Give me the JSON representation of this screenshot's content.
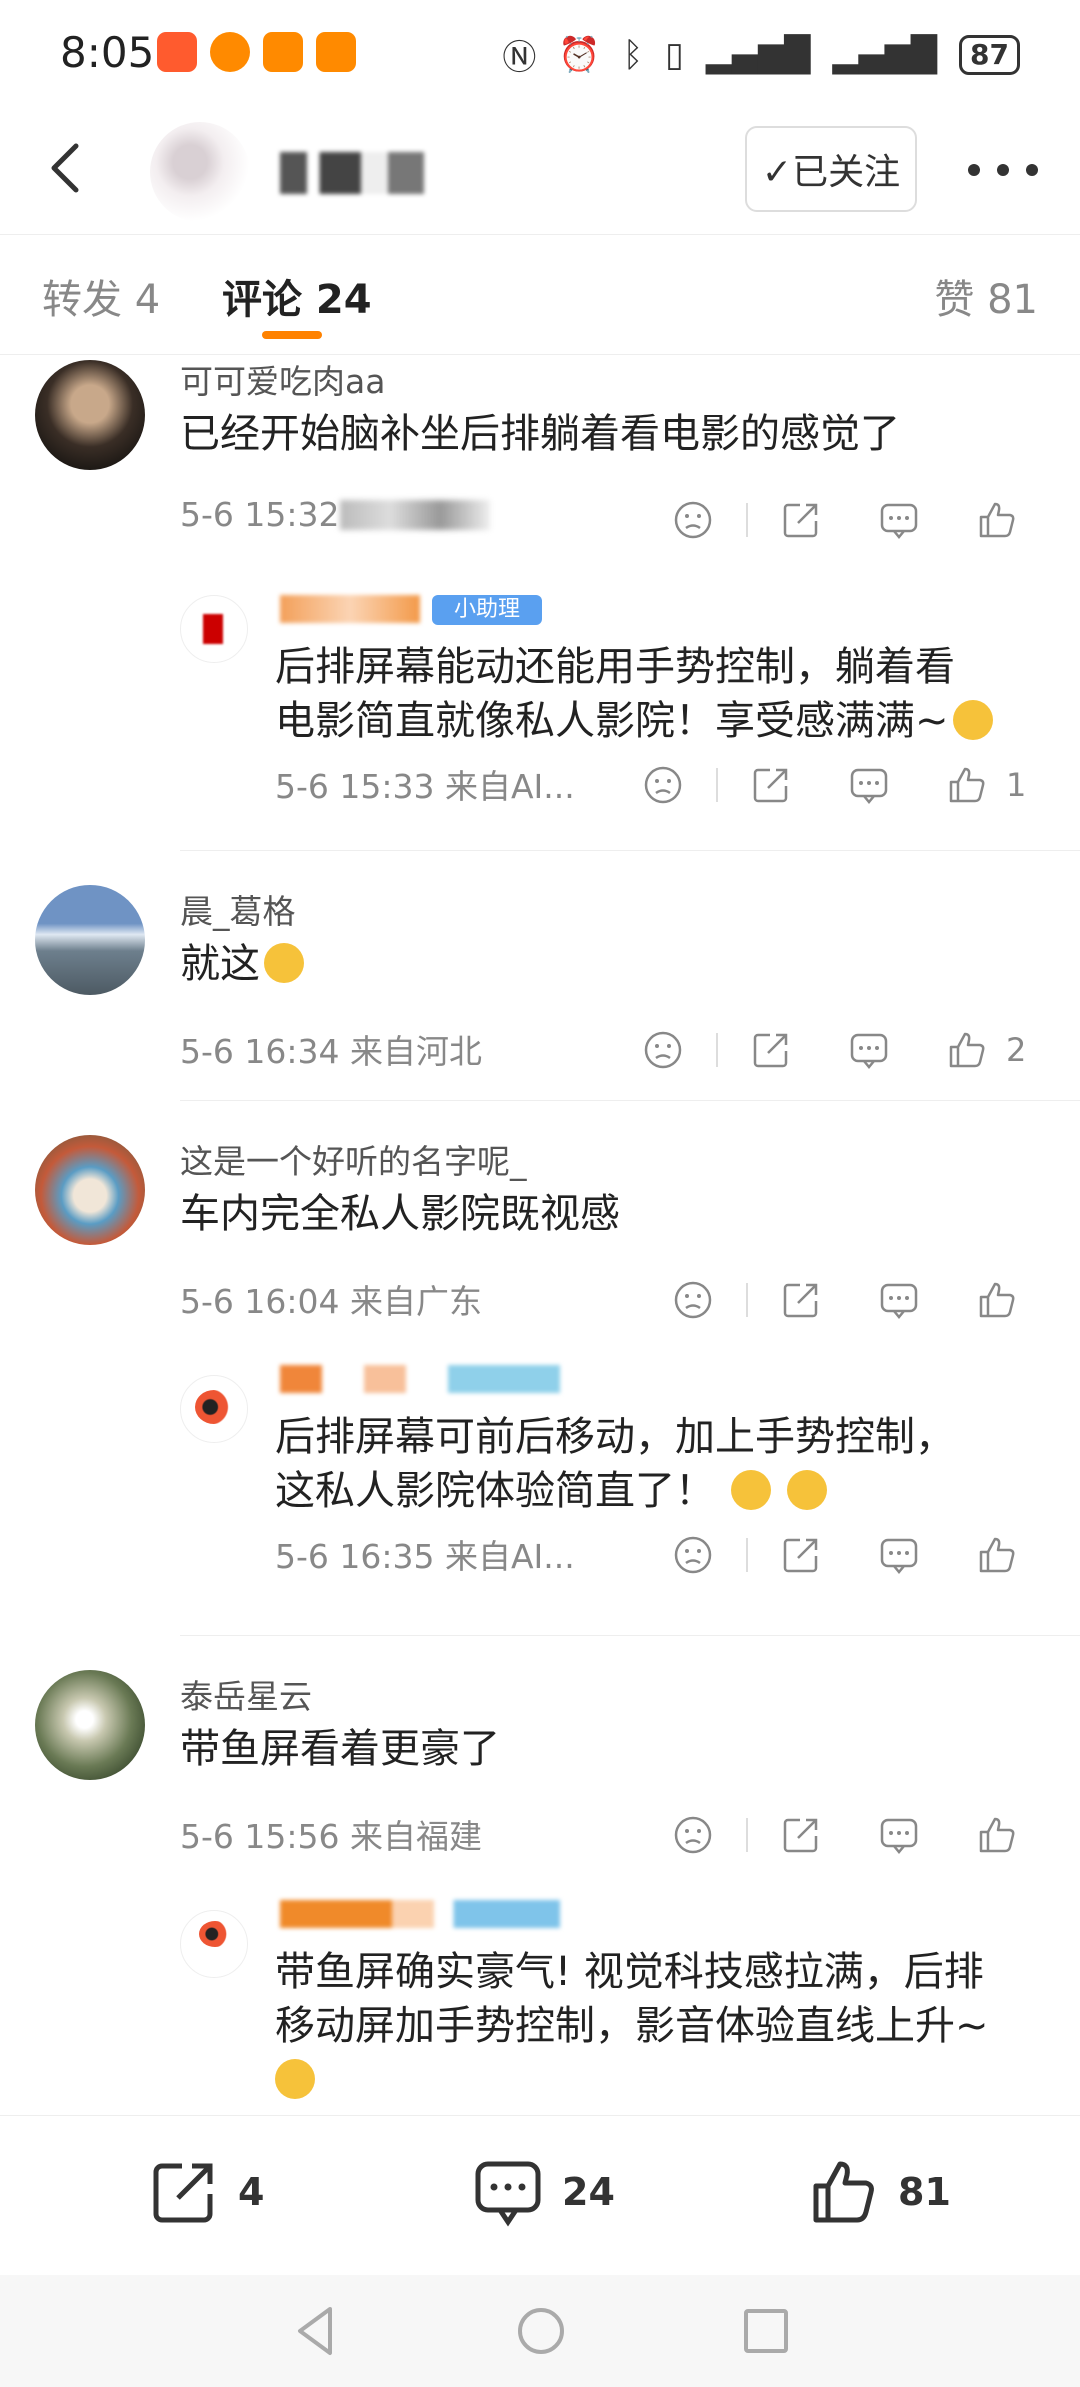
{
  "status": {
    "time": "8:05",
    "battery": "87",
    "app_colors": [
      "#ff5b2e",
      "#ff8a00",
      "#ff8a00",
      "#ff8a00"
    ]
  },
  "header": {
    "follow_label": "✓已关注"
  },
  "tabs": {
    "repost": "转发 4",
    "comments": "评论 24",
    "likes": "赞 81"
  },
  "comments": [
    {
      "name": "可可爱吃肉aa",
      "text": "已经开始脑补坐后排躺着看电影的感觉了",
      "meta": "5-6 15:32",
      "like_count": "",
      "reply": {
        "ai_tag": "小助理",
        "text_line1": "后排屏幕能动还能用手势控制，躺着看",
        "text_line2": "电影简直就像私人影院！享受感满满~",
        "meta": "5-6 15:33 来自AI...",
        "like_count": "1"
      }
    },
    {
      "name": "晨_葛格",
      "text": "就这",
      "meta": "5-6 16:34 来自河北",
      "like_count": "2"
    },
    {
      "name": "这是一个好听的名字呢_",
      "text": "车内完全私人影院既视感",
      "meta": "5-6 16:04 来自广东",
      "like_count": "",
      "reply": {
        "text_line1": "后排屏幕可前后移动，加上手势控制，",
        "text_line2": "这私人影院体验简直了！",
        "meta": "5-6 16:35 来自AI...",
        "like_count": ""
      }
    },
    {
      "name": "泰岳星云",
      "text": "带鱼屏看着更豪了",
      "meta": "5-6 15:56 来自福建",
      "like_count": "",
      "reply": {
        "text_line1": "带鱼屏确实豪气! 视觉科技感拉满，后排",
        "text_line2": "移动屏加手势控制，影音体验直线上升~"
      }
    }
  ],
  "bottom_bar": {
    "repost_count": "4",
    "comment_count": "24",
    "like_count": "81"
  },
  "colors": {
    "accent": "#ff8200",
    "ai_blue": "#5aa0f0"
  }
}
